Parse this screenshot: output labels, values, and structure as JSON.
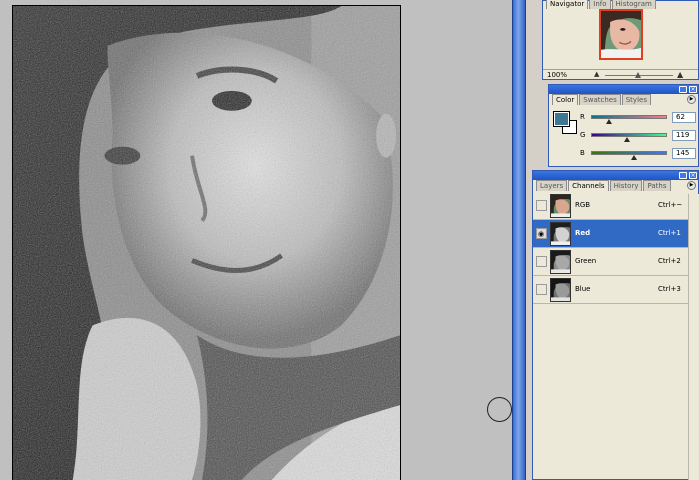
{
  "navigator": {
    "tabs": [
      "Navigator",
      "Info",
      "Histogram"
    ],
    "active_tab": "Navigator",
    "zoom": "100%"
  },
  "color": {
    "tabs": [
      "Color",
      "Swatches",
      "Styles"
    ],
    "active_tab": "Color",
    "foreground": "#3e7791",
    "background": "#ffffff",
    "sliders": [
      {
        "label": "R",
        "value": "62",
        "fraction": 0.24
      },
      {
        "label": "G",
        "value": "119",
        "fraction": 0.47
      },
      {
        "label": "B",
        "value": "145",
        "fraction": 0.57
      }
    ]
  },
  "layers_panel": {
    "tabs": [
      "Layers",
      "Channels",
      "History",
      "Paths"
    ],
    "active_tab": "Channels",
    "channels": [
      {
        "name": "RGB",
        "shortcut": "Ctrl+~",
        "visible": false,
        "selected": false
      },
      {
        "name": "Red",
        "shortcut": "Ctrl+1",
        "visible": true,
        "selected": true
      },
      {
        "name": "Green",
        "shortcut": "Ctrl+2",
        "visible": false,
        "selected": false
      },
      {
        "name": "Blue",
        "shortcut": "Ctrl+3",
        "visible": false,
        "selected": false
      }
    ]
  },
  "colors": {
    "selection": "#316ac5",
    "dock_blue": "#3a6fd0",
    "workspace": "#c0c0c0"
  }
}
